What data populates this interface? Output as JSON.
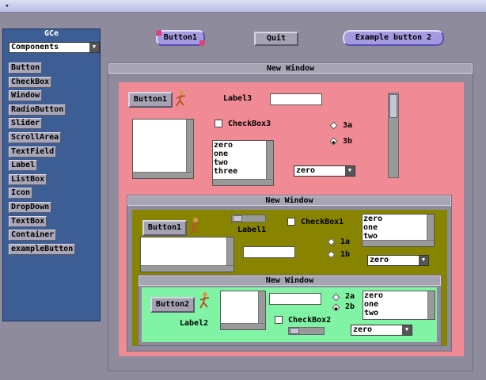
{
  "titlebar": {
    "arrow": "▾"
  },
  "sidebar": {
    "title": "GCe",
    "dropdown_value": "Components",
    "items": [
      {
        "label": "Button"
      },
      {
        "label": "CheckBox"
      },
      {
        "label": "Window"
      },
      {
        "label": "RadioButton"
      },
      {
        "label": "Slider"
      },
      {
        "label": "ScrollArea"
      },
      {
        "label": "TextField"
      },
      {
        "label": "Label"
      },
      {
        "label": "ListBox"
      },
      {
        "label": "Icon"
      },
      {
        "label": "DropDown"
      },
      {
        "label": "TextBox"
      },
      {
        "label": "Container"
      },
      {
        "label": "exampleButton"
      }
    ]
  },
  "topbar": {
    "button1": "Button1",
    "quit": "Quit",
    "example": "Example button 2"
  },
  "window1": {
    "title": "New Window",
    "button": "Button1",
    "label": "Label3",
    "checkbox": "CheckBox3",
    "radio_a": "3a",
    "radio_b": "3b",
    "list_items": [
      "zero",
      "one",
      "two",
      "three"
    ],
    "dropdown": "zero"
  },
  "window2": {
    "title": "New Window",
    "button": "Button1",
    "label": "Label1",
    "checkbox": "CheckBox1",
    "radio_a": "1a",
    "radio_b": "1b",
    "list_items": [
      "zero",
      "one",
      "two"
    ],
    "dropdown": "zero"
  },
  "window3": {
    "title": "New Window",
    "button": "Button2",
    "label": "Label2",
    "checkbox": "CheckBox2",
    "radio_a": "2a",
    "radio_b": "2b",
    "list_items": [
      "zero",
      "one",
      "two"
    ],
    "dropdown": "zero"
  },
  "icons": {
    "figure": "running-figure-icon"
  },
  "colors": {
    "pink": "#f08a94",
    "olive": "#888400",
    "green": "#80f4a4",
    "sidebar": "#3d5e94",
    "desktop": "#8e8c9c"
  }
}
